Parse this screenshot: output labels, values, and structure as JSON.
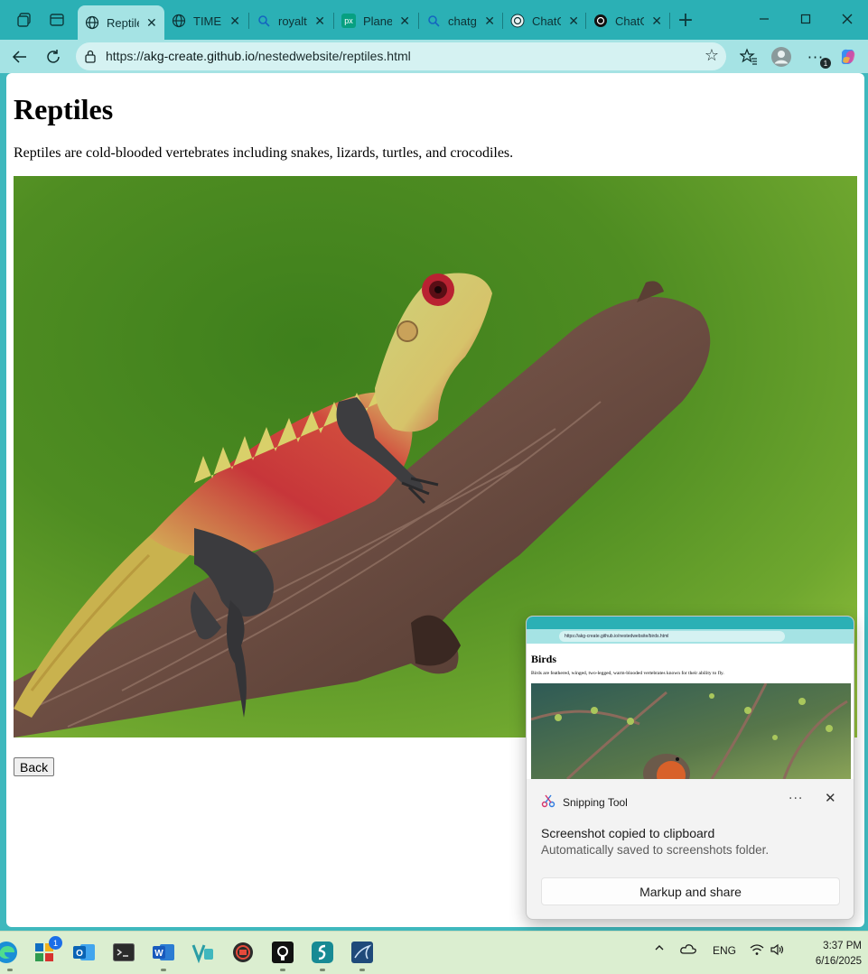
{
  "browser": {
    "tabs": [
      {
        "title": "Reptile",
        "icon": "globe-icon",
        "active": true
      },
      {
        "title": "TIME I",
        "icon": "globe-icon",
        "active": false
      },
      {
        "title": "royalty",
        "icon": "search-icon",
        "active": false
      },
      {
        "title": "Planet",
        "icon": "pexels-icon",
        "active": false
      },
      {
        "title": "chatgp",
        "icon": "search-icon",
        "active": false
      },
      {
        "title": "ChatG",
        "icon": "openai-icon",
        "active": false
      },
      {
        "title": "ChatG",
        "icon": "openai-icon",
        "active": false
      }
    ],
    "new_tab_label": "+",
    "url_prefix": "https://",
    "url_domain": "akg-create.github.io",
    "url_path": "/nestedwebsite/reptiles.html",
    "notification_count": "1"
  },
  "page": {
    "title": "Reptiles",
    "description": "Reptiles are cold-blooded vertebrates including snakes, lizards, turtles, and crocodiles.",
    "back_label": "Back"
  },
  "toast": {
    "thumb": {
      "url": "https://akg-create.github.io/nestedwebsite/birds.html",
      "title": "Birds",
      "description": "Birds are feathered, winged, two-legged, warm-blooded vertebrates known for their ability to fly."
    },
    "app_name": "Snipping Tool",
    "message": "Screenshot copied to clipboard",
    "sub": "Automatically saved to screenshots folder.",
    "action": "Markup and share"
  },
  "taskbar": {
    "start_badge": "1",
    "language": "ENG",
    "time": "3:37 PM",
    "date": "6/16/2025"
  },
  "colors": {
    "accent": "#2bb0b5",
    "address_bar": "#a5e3e4",
    "taskbar": "#dbeed0"
  }
}
